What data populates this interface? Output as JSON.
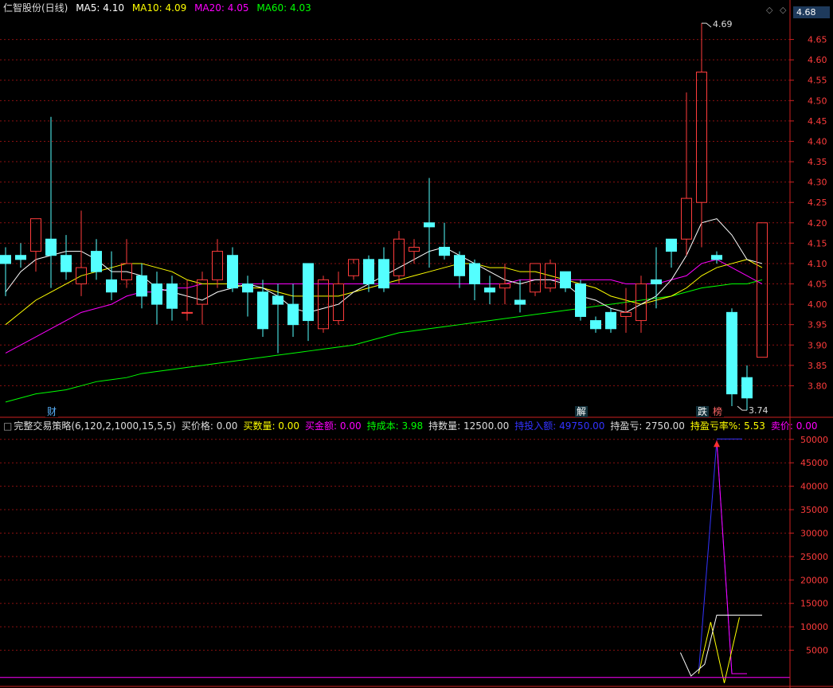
{
  "title": "仁智股份(日线)",
  "ma_labels": [
    {
      "text": "MA5: 4.10",
      "color": "#ffffff"
    },
    {
      "text": "MA10: 4.09",
      "color": "#ffff00"
    },
    {
      "text": "MA20: 4.05",
      "color": "#ff00ff"
    },
    {
      "text": "MA60: 4.03",
      "color": "#00ff00"
    }
  ],
  "current_price": "4.68",
  "indicator_labels": [
    {
      "text": "完整交易策略(6,120,2,1000,15,5,5)",
      "color": "#dddddd"
    },
    {
      "text": "买价格: 0.00",
      "color": "#dddddd"
    },
    {
      "text": "买数量: 0.00",
      "color": "#ffff00"
    },
    {
      "text": "买金额: 0.00",
      "color": "#ff00ff"
    },
    {
      "text": "持成本: 3.98",
      "color": "#00ff00"
    },
    {
      "text": "持数量: 12500.00",
      "color": "#dddddd"
    },
    {
      "text": "持投入额: 49750.00",
      "color": "#3333ff"
    },
    {
      "text": "持盈亏: 2750.00",
      "color": "#dddddd"
    },
    {
      "text": "持盈亏率%: 5.53",
      "color": "#ffff00"
    },
    {
      "text": "卖价: 0.00",
      "color": "#ff00ff"
    }
  ],
  "markers": [
    {
      "label": "财",
      "bg": "#000000",
      "fg": "#5ab4ff",
      "idx": 3
    },
    {
      "label": "解",
      "bg": "#12303a",
      "fg": "#ffffff",
      "idx": 38
    },
    {
      "label": "跌",
      "bg": "#12303a",
      "fg": "#ffffff",
      "idx": 46
    },
    {
      "label": "榜",
      "bg": "#000000",
      "fg": "#ff6666",
      "idx": 47
    }
  ],
  "colors": {
    "up": "#ff3c3c",
    "down": "#54ffff",
    "grid": "#8a1010",
    "axis": "#cc2020"
  },
  "chart_data": [
    {
      "type": "candlestick",
      "ylim": [
        3.75,
        4.7
      ],
      "yticks": [
        3.8,
        3.85,
        3.9,
        3.95,
        4.0,
        4.05,
        4.1,
        4.15,
        4.2,
        4.25,
        4.3,
        4.35,
        4.4,
        4.45,
        4.5,
        4.55,
        4.6,
        4.65
      ],
      "high_label": "4.69",
      "low_label": "3.74",
      "candles": [
        [
          4.12,
          4.1,
          4.14,
          4.02
        ],
        [
          4.12,
          4.11,
          4.15,
          4.09
        ],
        [
          4.13,
          4.21,
          4.21,
          4.08
        ],
        [
          4.16,
          4.12,
          4.46,
          4.04
        ],
        [
          4.12,
          4.08,
          4.17,
          4.06
        ],
        [
          4.05,
          4.09,
          4.23,
          4.02
        ],
        [
          4.13,
          4.08,
          4.16,
          4.06
        ],
        [
          4.06,
          4.03,
          4.13,
          4.01
        ],
        [
          4.06,
          4.1,
          4.16,
          4.04
        ],
        [
          4.07,
          4.02,
          4.1,
          3.99
        ],
        [
          4.05,
          4.0,
          4.08,
          3.95
        ],
        [
          4.05,
          3.99,
          4.07,
          3.96
        ],
        [
          3.98,
          3.98,
          4.06,
          3.96
        ],
        [
          4.0,
          4.06,
          4.08,
          3.95
        ],
        [
          4.06,
          4.13,
          4.16,
          4.04
        ],
        [
          4.12,
          4.04,
          4.14,
          4.03
        ],
        [
          4.05,
          4.03,
          4.07,
          3.97
        ],
        [
          4.03,
          3.94,
          4.06,
          3.92
        ],
        [
          4.02,
          4.0,
          4.05,
          3.88
        ],
        [
          4.0,
          3.95,
          4.05,
          3.92
        ],
        [
          4.1,
          3.96,
          4.1,
          3.91
        ],
        [
          3.94,
          4.06,
          4.07,
          3.93
        ],
        [
          3.96,
          4.05,
          4.08,
          3.95
        ],
        [
          4.07,
          4.11,
          4.1,
          4.06
        ],
        [
          4.11,
          4.05,
          4.12,
          4.03
        ],
        [
          4.11,
          4.04,
          4.14,
          4.03
        ],
        [
          4.07,
          4.16,
          4.18,
          4.05
        ],
        [
          4.13,
          4.14,
          4.16,
          4.1
        ],
        [
          4.2,
          4.19,
          4.31,
          4.09
        ],
        [
          4.14,
          4.12,
          4.2,
          4.11
        ],
        [
          4.12,
          4.07,
          4.13,
          4.04
        ],
        [
          4.1,
          4.05,
          4.11,
          4.01
        ],
        [
          4.04,
          4.03,
          4.07,
          4.0
        ],
        [
          4.04,
          4.05,
          4.1,
          4.0
        ],
        [
          4.01,
          4.0,
          4.06,
          3.98
        ],
        [
          4.03,
          4.1,
          4.1,
          4.02
        ],
        [
          4.04,
          4.1,
          4.11,
          4.03
        ],
        [
          4.08,
          4.04,
          4.08,
          4.03
        ],
        [
          4.05,
          3.97,
          4.06,
          3.96
        ],
        [
          3.96,
          3.94,
          3.97,
          3.93
        ],
        [
          3.98,
          3.94,
          3.99,
          3.93
        ],
        [
          3.97,
          3.98,
          4.04,
          3.93
        ],
        [
          3.96,
          4.05,
          4.07,
          3.93
        ],
        [
          4.06,
          4.05,
          4.14,
          3.99
        ],
        [
          4.16,
          4.13,
          4.16,
          4.09
        ],
        [
          4.16,
          4.26,
          4.52,
          4.12
        ],
        [
          4.25,
          4.57,
          4.69,
          4.14
        ],
        [
          4.12,
          4.11,
          4.13,
          4.1
        ],
        [
          3.98,
          3.78,
          3.99,
          3.75
        ],
        [
          3.82,
          3.77,
          3.85,
          3.74
        ],
        [
          3.87,
          4.2,
          4.2,
          3.87
        ]
      ],
      "ma5": [
        4.03,
        4.08,
        4.11,
        4.12,
        4.13,
        4.13,
        4.11,
        4.08,
        4.08,
        4.07,
        4.04,
        4.03,
        4.02,
        4.01,
        4.03,
        4.04,
        4.05,
        4.04,
        4.02,
        3.99,
        3.98,
        3.99,
        4.0,
        4.03,
        4.05,
        4.07,
        4.09,
        4.11,
        4.13,
        4.14,
        4.12,
        4.1,
        4.08,
        4.06,
        4.05,
        4.06,
        4.06,
        4.05,
        4.02,
        4.01,
        3.99,
        3.98,
        4.0,
        4.02,
        4.06,
        4.12,
        4.2,
        4.21,
        4.17,
        4.11,
        4.1
      ],
      "ma10": [
        3.95,
        3.98,
        4.01,
        4.03,
        4.05,
        4.07,
        4.08,
        4.09,
        4.1,
        4.1,
        4.09,
        4.08,
        4.06,
        4.05,
        4.05,
        4.05,
        4.04,
        4.04,
        4.03,
        4.02,
        4.02,
        4.02,
        4.02,
        4.03,
        4.04,
        4.05,
        4.06,
        4.07,
        4.08,
        4.09,
        4.1,
        4.1,
        4.09,
        4.09,
        4.08,
        4.08,
        4.07,
        4.06,
        4.05,
        4.04,
        4.02,
        4.01,
        4.0,
        4.01,
        4.02,
        4.04,
        4.07,
        4.09,
        4.1,
        4.11,
        4.09
      ],
      "ma20": [
        3.88,
        3.9,
        3.92,
        3.94,
        3.96,
        3.98,
        3.99,
        4.0,
        4.02,
        4.03,
        4.03,
        4.04,
        4.04,
        4.05,
        4.05,
        4.05,
        4.05,
        4.05,
        4.05,
        4.05,
        4.05,
        4.05,
        4.05,
        4.05,
        4.05,
        4.05,
        4.05,
        4.05,
        4.05,
        4.05,
        4.05,
        4.05,
        4.05,
        4.05,
        4.06,
        4.06,
        4.06,
        4.06,
        4.06,
        4.06,
        4.06,
        4.05,
        4.05,
        4.05,
        4.06,
        4.07,
        4.1,
        4.11,
        4.09,
        4.07,
        4.05
      ],
      "ma60": [
        3.76,
        3.77,
        3.78,
        3.785,
        3.79,
        3.8,
        3.81,
        3.815,
        3.82,
        3.83,
        3.835,
        3.84,
        3.845,
        3.85,
        3.855,
        3.86,
        3.865,
        3.87,
        3.875,
        3.88,
        3.885,
        3.89,
        3.895,
        3.9,
        3.91,
        3.92,
        3.93,
        3.935,
        3.94,
        3.945,
        3.95,
        3.955,
        3.96,
        3.965,
        3.97,
        3.975,
        3.98,
        3.985,
        3.99,
        3.995,
        4.0,
        4.005,
        4.01,
        4.015,
        4.02,
        4.03,
        4.04,
        4.045,
        4.05,
        4.05,
        4.06
      ]
    },
    {
      "type": "line",
      "ylim": [
        0,
        52000
      ],
      "yticks": [
        5000,
        10000,
        15000,
        20000,
        25000,
        30000,
        35000,
        40000,
        45000,
        50000
      ],
      "series": [
        {
          "color": "#3333ff",
          "points": [
            [
              45.8,
              0
            ],
            [
              47,
              49750
            ],
            [
              48,
              0
            ]
          ]
        },
        {
          "color": "#ff00ff",
          "points": [
            [
              47,
              49750
            ],
            [
              48,
              0
            ],
            [
              49,
              0
            ]
          ]
        },
        {
          "color": "#ffff00",
          "points": [
            [
              45.8,
              0
            ],
            [
              46.6,
              11000
            ],
            [
              47.5,
              -2000
            ],
            [
              48.5,
              12000
            ]
          ]
        },
        {
          "color": "#ffffff",
          "points": [
            [
              44.6,
              4500
            ],
            [
              45.3,
              -500
            ],
            [
              46.2,
              2000
            ],
            [
              47,
              12500
            ],
            [
              48.2,
              12500
            ],
            [
              50,
              12500
            ]
          ]
        }
      ],
      "hline": {
        "color": "#ff00ff",
        "value": -800
      }
    }
  ]
}
